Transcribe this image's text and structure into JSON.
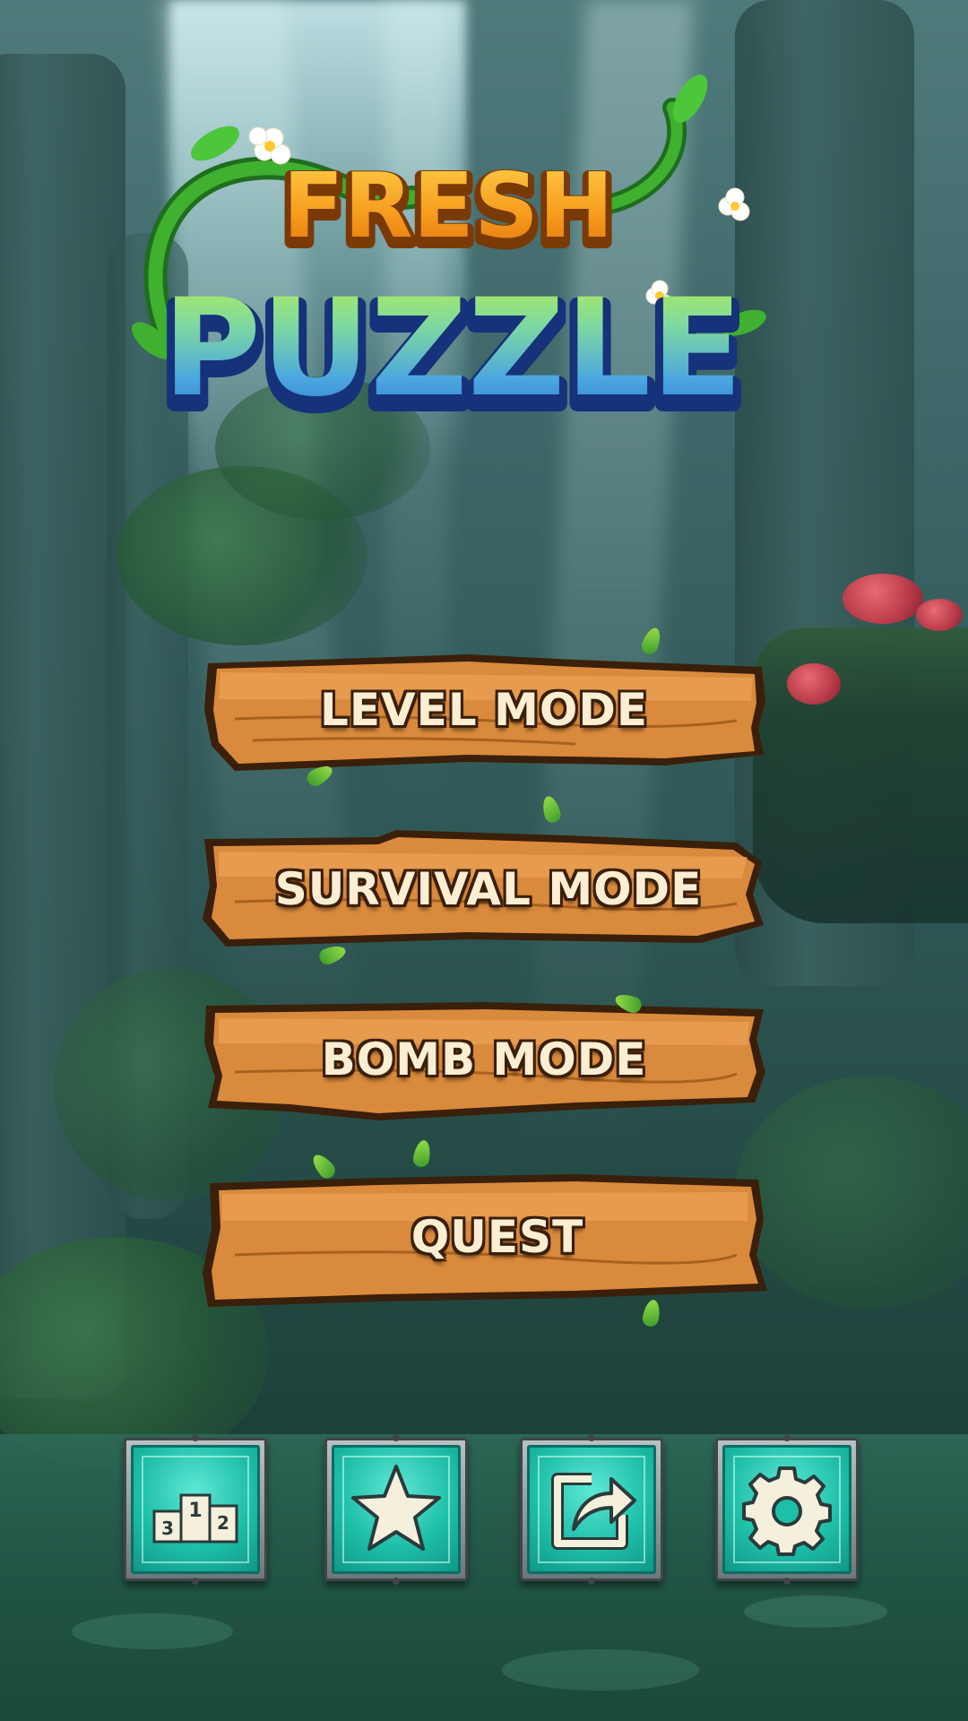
{
  "logo": {
    "line1": "FRESH",
    "line2": "PUZZLE"
  },
  "menu": {
    "items": [
      {
        "label": "LEVEL MODE"
      },
      {
        "label": "SURVIVAL MODE"
      },
      {
        "label": "BOMB MODE"
      },
      {
        "label": "QUEST"
      }
    ]
  },
  "toolbar": {
    "buttons": [
      {
        "icon": "leaderboard-podium-icon",
        "podium": [
          "3",
          "1",
          "2"
        ]
      },
      {
        "icon": "star-icon"
      },
      {
        "icon": "share-icon"
      },
      {
        "icon": "gear-icon"
      }
    ]
  },
  "colors": {
    "wood": "#d98a3c",
    "wood_outline": "#3a1f0a",
    "label_text": "#fbeed2",
    "tile_teal": "#1ebfa8",
    "logo_orange": "#f59a1c",
    "logo_blue": "#3a8fd8",
    "vine_green": "#2f9a2a"
  }
}
